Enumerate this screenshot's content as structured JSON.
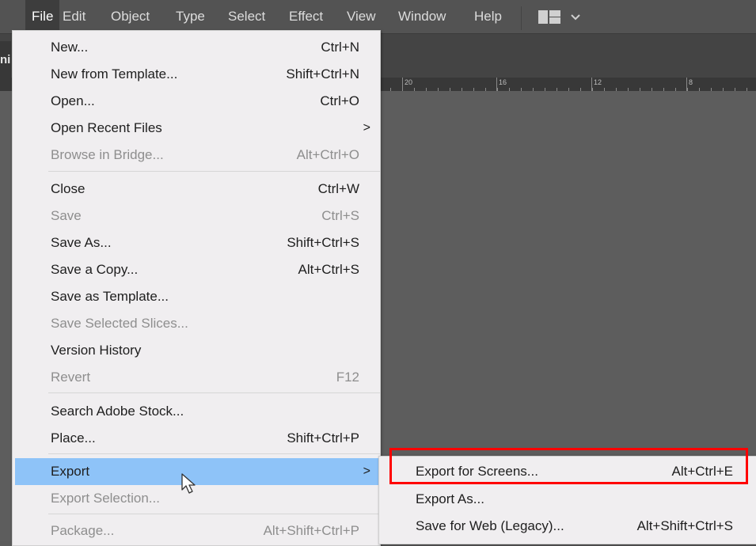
{
  "menubar": {
    "items": [
      {
        "label": "File",
        "active": true
      },
      {
        "label": "Edit"
      },
      {
        "label": "Object"
      },
      {
        "label": "Type"
      },
      {
        "label": "Select"
      },
      {
        "label": "Effect"
      },
      {
        "label": "View"
      },
      {
        "label": "Window"
      },
      {
        "label": "Help"
      }
    ],
    "workspace_icon": "workspace-layout-icon",
    "workspace_chevron": "chevron-down-icon"
  },
  "document_tab": {
    "partial_label": "ni"
  },
  "ruler": {
    "labels": [
      "20",
      "16",
      "12",
      "8"
    ]
  },
  "file_menu": {
    "items": [
      {
        "label": "New...",
        "shortcut": "Ctrl+N"
      },
      {
        "label": "New from Template...",
        "shortcut": "Shift+Ctrl+N"
      },
      {
        "label": "Open...",
        "shortcut": "Ctrl+O"
      },
      {
        "label": "Open Recent Files",
        "shortcut": "",
        "submenu": true
      },
      {
        "label": "Browse in Bridge...",
        "shortcut": "Alt+Ctrl+O",
        "disabled": true
      },
      {
        "label": "Close",
        "shortcut": "Ctrl+W"
      },
      {
        "label": "Save",
        "shortcut": "Ctrl+S",
        "disabled": true
      },
      {
        "label": "Save As...",
        "shortcut": "Shift+Ctrl+S"
      },
      {
        "label": "Save a Copy...",
        "shortcut": "Alt+Ctrl+S"
      },
      {
        "label": "Save as Template...",
        "shortcut": ""
      },
      {
        "label": "Save Selected Slices...",
        "shortcut": "",
        "disabled": true
      },
      {
        "label": "Version History",
        "shortcut": ""
      },
      {
        "label": "Revert",
        "shortcut": "F12",
        "disabled": true
      },
      {
        "label": "Search Adobe Stock...",
        "shortcut": ""
      },
      {
        "label": "Place...",
        "shortcut": "Shift+Ctrl+P"
      },
      {
        "label": "Export",
        "shortcut": "",
        "submenu": true,
        "highlighted": true
      },
      {
        "label": "Export Selection...",
        "shortcut": "",
        "disabled": true
      },
      {
        "label": "Package...",
        "shortcut": "Alt+Shift+Ctrl+P",
        "disabled": true
      }
    ],
    "submenu_arrow": ">"
  },
  "export_submenu": {
    "items": [
      {
        "label": "Export for Screens...",
        "shortcut": "Alt+Ctrl+E",
        "annotated": true
      },
      {
        "label": "Export As...",
        "shortcut": ""
      },
      {
        "label": "Save for Web (Legacy)...",
        "shortcut": "Alt+Shift+Ctrl+S"
      }
    ]
  },
  "annotation": {
    "color": "#ff0000"
  },
  "colors": {
    "menubar_bg": "#535353",
    "menu_bg": "#f0eef0",
    "highlight": "#8ec3f8",
    "disabled_text": "#8e8e8e"
  }
}
